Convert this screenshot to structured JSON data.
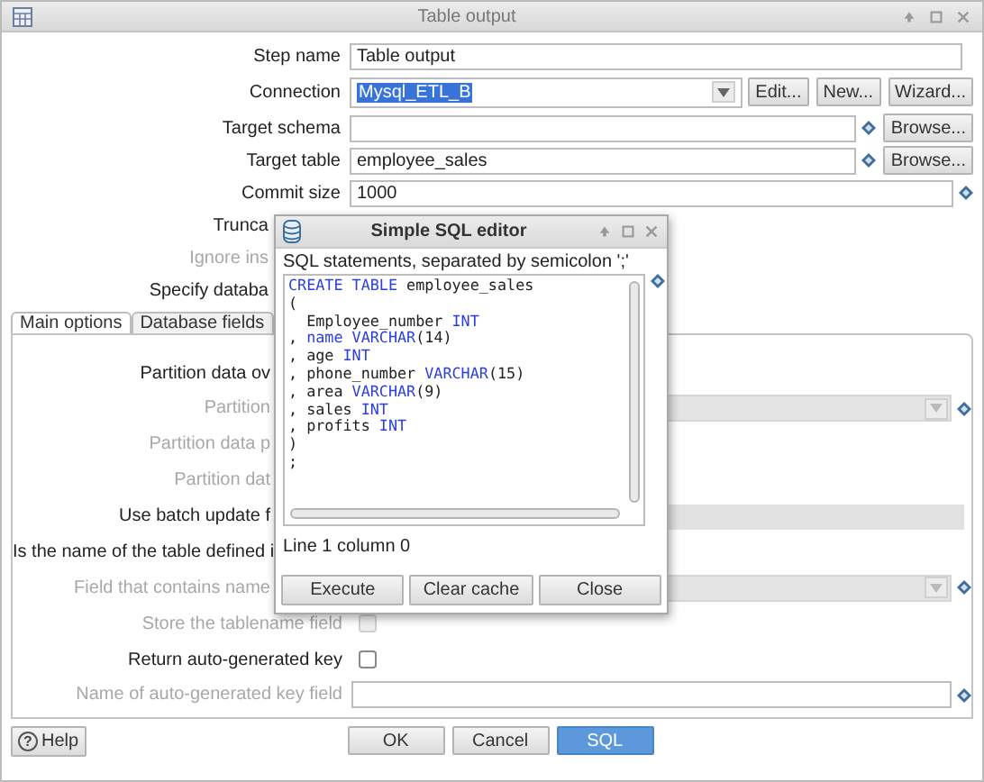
{
  "window": {
    "title": "Table output"
  },
  "fields": [
    {
      "label": "Step name",
      "kind": "text",
      "disabled": false,
      "value": "Table output"
    },
    {
      "label": "Connection",
      "kind": "connection",
      "disabled": false,
      "value": "Mysql_ETL_B",
      "value_selected": true,
      "buttons": [
        "Edit...",
        "New...",
        "Wizard..."
      ]
    },
    {
      "label": "Target schema",
      "kind": "browse",
      "disabled": false,
      "button": "Browse..."
    },
    {
      "label": "Target table",
      "kind": "browse",
      "disabled": false,
      "value": "employee_sales",
      "button": "Browse..."
    },
    {
      "label": "Commit size",
      "kind": "variable",
      "disabled": false,
      "value": "1000"
    },
    {
      "label": "Trunca",
      "kind": "label",
      "disabled": false
    },
    {
      "label": "Ignore ins",
      "kind": "label",
      "disabled": true
    },
    {
      "label": "Specify databa",
      "kind": "label",
      "disabled": false
    }
  ],
  "tabs": [
    {
      "label": "Main options",
      "selected": true
    },
    {
      "label": "Database fields",
      "selected": false
    }
  ],
  "main_options": [
    {
      "label": "Partition data ov",
      "kind": "label",
      "disabled": false
    },
    {
      "label": "Partition",
      "kind": "combo",
      "disabled": true
    },
    {
      "label": "Partition data p",
      "kind": "label",
      "disabled": true
    },
    {
      "label": "Partition dat",
      "kind": "label",
      "disabled": true
    },
    {
      "label": "Use batch update f",
      "kind": "bar",
      "disabled": false
    },
    {
      "label": "Is the name of the table defined i",
      "kind": "label",
      "disabled": false
    },
    {
      "label": "Field that contains name",
      "kind": "combo",
      "disabled": true
    },
    {
      "label": "Store the tablename field",
      "kind": "checkbox",
      "disabled": true,
      "checked": false
    },
    {
      "label": "Return auto-generated key",
      "kind": "checkbox",
      "disabled": false,
      "checked": false
    },
    {
      "label": "Name of auto-generated key field",
      "kind": "variable",
      "disabled": true
    }
  ],
  "help_button": {
    "icon_glyph": "?",
    "label": "Help"
  },
  "buttons": [
    {
      "label": "OK",
      "primary": false
    },
    {
      "label": "Cancel",
      "primary": false
    },
    {
      "label": "SQL",
      "primary": true
    }
  ],
  "sql_dialog": {
    "title": "Simple SQL editor",
    "hint": "SQL statements, separated by semicolon ';'",
    "lines": [
      [
        {
          "text": "CREATE TABLE",
          "kind": "keyword"
        },
        {
          "text": " employee_sales",
          "kind": "plain"
        }
      ],
      [
        {
          "text": "(",
          "kind": "plain"
        }
      ],
      [
        {
          "text": "  Employee_number ",
          "kind": "plain"
        },
        {
          "text": "INT",
          "kind": "keyword"
        }
      ],
      [
        {
          "text": ", ",
          "kind": "plain"
        },
        {
          "text": "name VARCHAR",
          "kind": "keyword"
        },
        {
          "text": "(14)",
          "kind": "plain"
        }
      ],
      [
        {
          "text": ", age ",
          "kind": "plain"
        },
        {
          "text": "INT",
          "kind": "keyword"
        }
      ],
      [
        {
          "text": ", phone_number ",
          "kind": "plain"
        },
        {
          "text": "VARCHAR",
          "kind": "keyword"
        },
        {
          "text": "(15)",
          "kind": "plain"
        }
      ],
      [
        {
          "text": ", area ",
          "kind": "plain"
        },
        {
          "text": "VARCHAR",
          "kind": "keyword"
        },
        {
          "text": "(9)",
          "kind": "plain"
        }
      ],
      [
        {
          "text": ", sales ",
          "kind": "plain"
        },
        {
          "text": "INT",
          "kind": "keyword"
        }
      ],
      [
        {
          "text": ", profits ",
          "kind": "plain"
        },
        {
          "text": "INT",
          "kind": "keyword"
        }
      ],
      [
        {
          "text": ")",
          "kind": "plain"
        }
      ],
      [
        {
          "text": ";",
          "kind": "plain"
        }
      ]
    ],
    "status": "Line 1 column 0",
    "buttons": [
      "Execute",
      "Clear cache",
      "Close"
    ]
  }
}
